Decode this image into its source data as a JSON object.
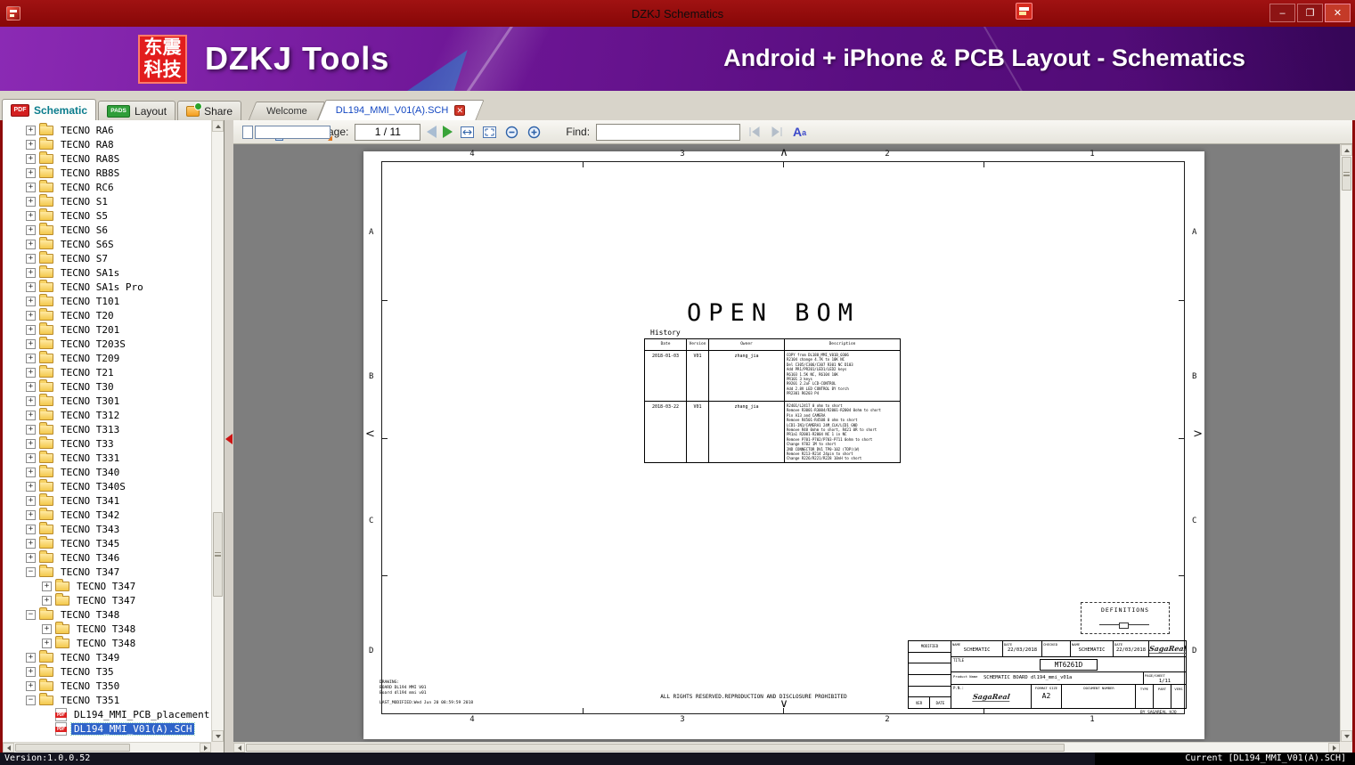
{
  "titlebar": {
    "title": "DZKJ Schematics",
    "buttons": {
      "minimize": "–",
      "restore": "❐",
      "close": "✕"
    }
  },
  "banner": {
    "logo_line1": "东震",
    "logo_line2": "科技",
    "brand": "DZKJ Tools",
    "tagline": "Android + iPhone & PCB Layout - Schematics"
  },
  "icons": {
    "pdf": "PDF",
    "pads": "PADS"
  },
  "tabs": {
    "schematic": "Schematic",
    "layout": "Layout",
    "share": "Share",
    "welcome": "Welcome",
    "document": "DL194_MMI_V01(A).SCH",
    "close": "✕"
  },
  "toolbar": {
    "page_label": "Page:",
    "page_value": "1 / 11",
    "find_label": "Find:",
    "find_value": "",
    "font_big": "A",
    "font_small": "a"
  },
  "sidebar": {
    "items": [
      {
        "label": "TECNO RA6",
        "level": 0,
        "exp": "plus",
        "icon": "folder"
      },
      {
        "label": "TECNO RA8",
        "level": 0,
        "exp": "plus",
        "icon": "folder"
      },
      {
        "label": "TECNO RA8S",
        "level": 0,
        "exp": "plus",
        "icon": "folder"
      },
      {
        "label": "TECNO RB8S",
        "level": 0,
        "exp": "plus",
        "icon": "folder"
      },
      {
        "label": "TECNO RC6",
        "level": 0,
        "exp": "plus",
        "icon": "folder"
      },
      {
        "label": "TECNO S1",
        "level": 0,
        "exp": "plus",
        "icon": "folder"
      },
      {
        "label": "TECNO S5",
        "level": 0,
        "exp": "plus",
        "icon": "folder"
      },
      {
        "label": "TECNO S6",
        "level": 0,
        "exp": "plus",
        "icon": "folder"
      },
      {
        "label": "TECNO S6S",
        "level": 0,
        "exp": "plus",
        "icon": "folder"
      },
      {
        "label": "TECNO S7",
        "level": 0,
        "exp": "plus",
        "icon": "folder"
      },
      {
        "label": "TECNO SA1s",
        "level": 0,
        "exp": "plus",
        "icon": "folder"
      },
      {
        "label": "TECNO SA1s Pro",
        "level": 0,
        "exp": "plus",
        "icon": "folder"
      },
      {
        "label": "TECNO T101",
        "level": 0,
        "exp": "plus",
        "icon": "folder"
      },
      {
        "label": "TECNO T20",
        "level": 0,
        "exp": "plus",
        "icon": "folder"
      },
      {
        "label": "TECNO T201",
        "level": 0,
        "exp": "plus",
        "icon": "folder"
      },
      {
        "label": "TECNO T203S",
        "level": 0,
        "exp": "plus",
        "icon": "folder"
      },
      {
        "label": "TECNO T209",
        "level": 0,
        "exp": "plus",
        "icon": "folder"
      },
      {
        "label": "TECNO T21",
        "level": 0,
        "exp": "plus",
        "icon": "folder"
      },
      {
        "label": "TECNO T30",
        "level": 0,
        "exp": "plus",
        "icon": "folder"
      },
      {
        "label": "TECNO T301",
        "level": 0,
        "exp": "plus",
        "icon": "folder"
      },
      {
        "label": "TECNO T312",
        "level": 0,
        "exp": "plus",
        "icon": "folder"
      },
      {
        "label": "TECNO T313",
        "level": 0,
        "exp": "plus",
        "icon": "folder"
      },
      {
        "label": "TECNO T33",
        "level": 0,
        "exp": "plus",
        "icon": "folder"
      },
      {
        "label": "TECNO T331",
        "level": 0,
        "exp": "plus",
        "icon": "folder"
      },
      {
        "label": "TECNO T340",
        "level": 0,
        "exp": "plus",
        "icon": "folder"
      },
      {
        "label": "TECNO T340S",
        "level": 0,
        "exp": "plus",
        "icon": "folder"
      },
      {
        "label": "TECNO T341",
        "level": 0,
        "exp": "plus",
        "icon": "folder"
      },
      {
        "label": "TECNO T342",
        "level": 0,
        "exp": "plus",
        "icon": "folder"
      },
      {
        "label": "TECNO T343",
        "level": 0,
        "exp": "plus",
        "icon": "folder"
      },
      {
        "label": "TECNO T345",
        "level": 0,
        "exp": "plus",
        "icon": "folder"
      },
      {
        "label": "TECNO T346",
        "level": 0,
        "exp": "plus",
        "icon": "folder"
      },
      {
        "label": "TECNO T347",
        "level": 0,
        "exp": "minus",
        "icon": "folder"
      },
      {
        "label": "TECNO T347",
        "level": 1,
        "exp": "plus",
        "icon": "folder"
      },
      {
        "label": "TECNO T347",
        "level": 1,
        "exp": "plus",
        "icon": "folder"
      },
      {
        "label": "TECNO T348",
        "level": 0,
        "exp": "minus",
        "icon": "folder"
      },
      {
        "label": "TECNO T348",
        "level": 1,
        "exp": "plus",
        "icon": "folder"
      },
      {
        "label": "TECNO T348",
        "level": 1,
        "exp": "plus",
        "icon": "folder"
      },
      {
        "label": "TECNO T349",
        "level": 0,
        "exp": "plus",
        "icon": "folder"
      },
      {
        "label": "TECNO T35",
        "level": 0,
        "exp": "plus",
        "icon": "folder"
      },
      {
        "label": "TECNO T350",
        "level": 0,
        "exp": "plus",
        "icon": "folder"
      },
      {
        "label": "TECNO T351",
        "level": 0,
        "exp": "minus",
        "icon": "folder"
      },
      {
        "label": "DL194_MMI_PCB_placement",
        "level": 1,
        "exp": "none",
        "icon": "pdf"
      },
      {
        "label": "DL194_MMI_V01(A).SCH",
        "level": 1,
        "exp": "none",
        "icon": "pdf",
        "selected": true
      }
    ]
  },
  "schematic": {
    "title": "OPEN BOM",
    "history_label": "History",
    "grid_cols": [
      "4",
      "3",
      "2",
      "1"
    ],
    "grid_rows": [
      "A",
      "B",
      "C",
      "D"
    ],
    "marks": {
      "top": "∧",
      "bottom": "∨",
      "left": "<",
      "right": ">"
    },
    "rights": "ALL RIGHTS RESERVED.REPRODUCTION AND DISCLOSURE PROHIBITED",
    "drawing": {
      "line1": "DRAWING:",
      "line2": "BOARD DL194 MMI V01",
      "line3": "Board dl194 mmi v01",
      "line4": "LAST_MODIFIED:Wed Jun 20 08:59:59 2018"
    },
    "definitions_label": "DEFINITIONS",
    "history_table": {
      "headers": [
        "Date",
        "Version",
        "Owner",
        "Description"
      ],
      "rows": [
        {
          "date": "2018-01-03",
          "ver": "V01",
          "owner": "zhang_jia",
          "desc": [
            "COPY from DL188_MMI_V01B_0306",
            "R2104 change 4.7K to 10K NC",
            "Del C305/C306/C307 R301 NC D103",
            "Add PR1/PR201/LED1/LED2 keys",
            "R6103 1.5K NC, R6104 10K",
            "PR101 3 keys",
            "R9201 2.2uF LCD-CONTROL",
            "Add 2.8V LED CONTROL BY torch",
            "PR2301 R6203 P4"
          ]
        },
        {
          "date": "2018-03-22",
          "ver": "V01",
          "owner": "zhang_jia",
          "desc": [
            "R2401/L2417 0 ohm to short",
            "Remove R3001-R3004/R2001-R2004 0ohm to short",
            "Pin A13 and CAMERA",
            "Remove R4501-R4508 0 ohm to short",
            "LCD1-IN1/CAMERA1 24M_CLK/LCD1 GND",
            "Remove R48 0ohm to short, R421 0R to short",
            "PR1a1 R2001-R2004 NC 1 in NC",
            "Remove P701-P702/P703-P711 0ohm to short",
            "Change V702 1M to short",
            "2ND CONNECTOR DV1 TP0-102 (TOP)(W)",
            "Remove R213-R214 24pin to short",
            "Change R226/R221/R228 10nH to short"
          ]
        }
      ]
    },
    "titleblock": {
      "modified_label": "MODIFIED",
      "ver_label": "VER",
      "date_col_label": "DATE",
      "name_label": "NAME",
      "date_label": "DATE",
      "checked_label": "CHECKED",
      "schematic_value": "SCHEMATIC",
      "date_value": "22/03/2018",
      "title_label": "TITLE",
      "title_value": "MT6261D",
      "product_label": "Product Name",
      "product_value": "SCHEMATIC BOARD dl194_mmi_v01a",
      "page_sheet_label": "PAGE/SHEET",
      "page_sheet_value": "1/11",
      "pn_label": "P.N.:",
      "format_label": "FORMAT SIZE",
      "format_value": "A2",
      "doc_number_label": "DOCUMENT NUMBER",
      "type_label": "TYPE",
      "part_label": "PART",
      "vers_label": "VERS",
      "logo": "SagaReal",
      "by_line": "BY SAGAREAL HJQ"
    }
  },
  "statusbar": {
    "version": "Version:1.0.0.52",
    "current": "Current [DL194_MMI_V01(A).SCH]"
  }
}
